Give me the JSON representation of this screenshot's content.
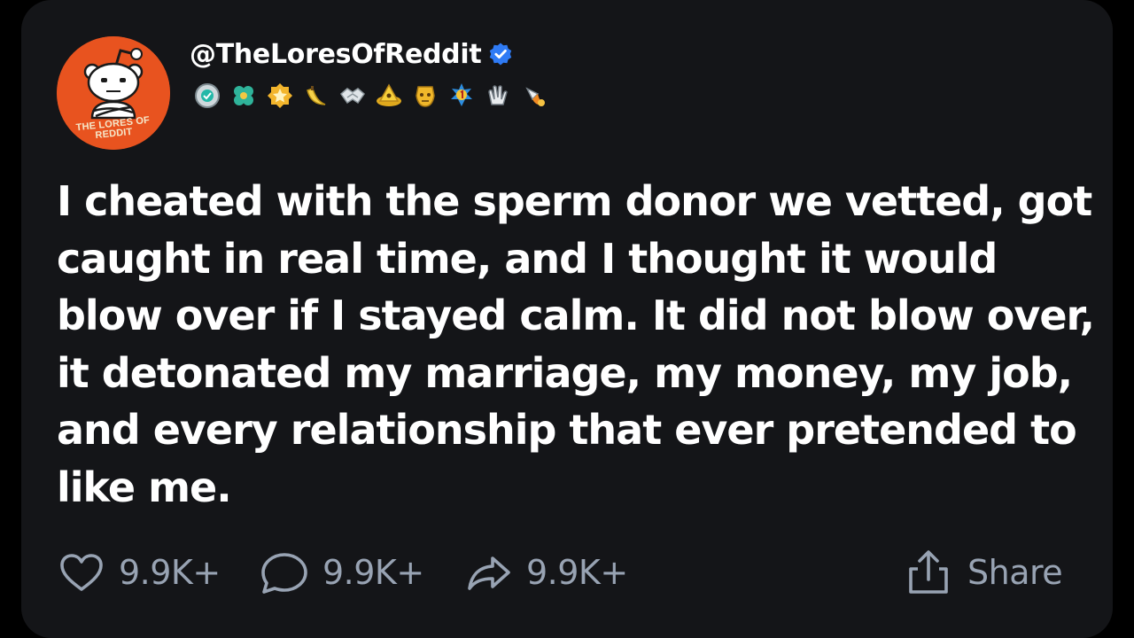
{
  "profile": {
    "handle": "@TheLoresOfReddit",
    "verified": true,
    "avatar_text": "THE LORES OF\nREDDIT",
    "avatar_color": "#e8531f",
    "verified_color": "#2f7bf5"
  },
  "awards": [
    {
      "icon": "silver-medal-icon"
    },
    {
      "icon": "clover-award-icon"
    },
    {
      "icon": "gold-star-badge-icon"
    },
    {
      "icon": "banana-icon"
    },
    {
      "icon": "handshake-icon"
    },
    {
      "icon": "gold-triangle-award-icon"
    },
    {
      "icon": "golden-mask-icon"
    },
    {
      "icon": "number-one-badge-icon"
    },
    {
      "icon": "clapping-hands-icon"
    },
    {
      "icon": "rocket-like-icon"
    }
  ],
  "post": {
    "text": "I cheated with the sperm donor we vetted, got caught in real time, and I thought it would blow over if I stayed calm. It did not blow over, it detonated my marriage, my money, my job, and every relationship that ever pretended to like me."
  },
  "actions": {
    "likes": "9.9K+",
    "comments": "9.9K+",
    "reposts": "9.9K+",
    "share_label": "Share"
  },
  "colors": {
    "card_background": "#141518",
    "action_color": "#98a3b3",
    "text_color": "#ffffff"
  }
}
